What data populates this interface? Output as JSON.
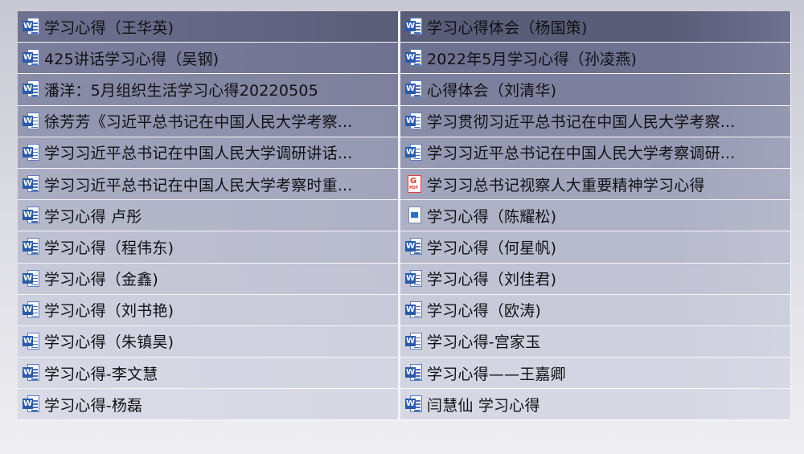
{
  "files": {
    "left": [
      {
        "name": "学习心得（王华英)",
        "type": "word"
      },
      {
        "name": "425讲话学习心得（吴钢)",
        "type": "word"
      },
      {
        "name": "潘洋：5月组织生活学习心得20220505",
        "type": "word"
      },
      {
        "name": "徐芳芳《习近平总书记在中国人民大学考察...",
        "type": "word"
      },
      {
        "name": "学习习近平总书记在中国人民大学调研讲话...",
        "type": "word"
      },
      {
        "name": "学习习近平总书记在中国人民大学考察时重...",
        "type": "word"
      },
      {
        "name": "学习心得 卢彤",
        "type": "word"
      },
      {
        "name": "学习心得（程伟东)",
        "type": "word"
      },
      {
        "name": "学习心得（金鑫)",
        "type": "word"
      },
      {
        "name": "学习心得（刘书艳)",
        "type": "word"
      },
      {
        "name": "学习心得（朱镇昊)",
        "type": "word"
      },
      {
        "name": "学习心得-李文慧",
        "type": "word"
      },
      {
        "name": "学习心得-杨磊",
        "type": "word"
      }
    ],
    "right": [
      {
        "name": "学习心得体会（杨国策)",
        "type": "word"
      },
      {
        "name": "2022年5月学习心得（孙凌燕)",
        "type": "word"
      },
      {
        "name": "心得体会（刘清华)",
        "type": "word"
      },
      {
        "name": "学习贯彻习近平总书记在中国人民大学考察...",
        "type": "word"
      },
      {
        "name": "学习习近平总书记在中国人民大学考察调研...",
        "type": "word"
      },
      {
        "name": "学习习总书记视察人大重要精神学习心得",
        "type": "pdf"
      },
      {
        "name": "学习心得（陈耀松)",
        "type": "image"
      },
      {
        "name": "学习心得（何星帆)",
        "type": "word"
      },
      {
        "name": "学习心得（刘佳君)",
        "type": "word"
      },
      {
        "name": "学习心得（欧涛)",
        "type": "word"
      },
      {
        "name": "学习心得-宫家玉",
        "type": "word"
      },
      {
        "name": "学习心得——王嘉卿",
        "type": "word"
      },
      {
        "name": "闫慧仙 学习心得",
        "type": "word"
      }
    ]
  },
  "icons": {
    "word": "word-doc-icon",
    "pdf": "pdf-doc-icon",
    "image": "image-file-icon"
  },
  "colors": {
    "selection_dark": "#3c3f5c",
    "selection_light": "#d9dae6",
    "text": "#101014",
    "word_blue": "#2a5aa8",
    "pdf_red": "#d33a2b"
  }
}
